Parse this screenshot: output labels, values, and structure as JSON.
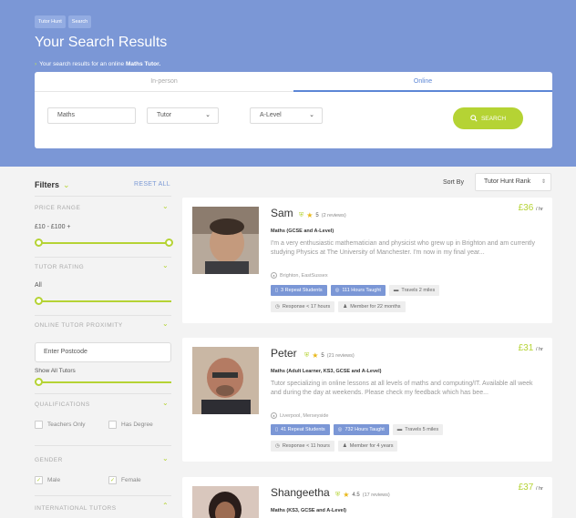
{
  "breadcrumbs": [
    "Tutor Hunt",
    "Search"
  ],
  "hero": {
    "title": "Your Search Results",
    "subtitle_pre": "Your search results for an online",
    "subtitle_subject": "Maths Tutor."
  },
  "search": {
    "tabs": [
      {
        "label": "In-person"
      },
      {
        "label": "Online"
      }
    ],
    "subject_value": "Maths",
    "type_value": "Tutor",
    "level_value": "A-Level",
    "button_label": "SEARCH"
  },
  "filters": {
    "title": "Filters",
    "reset_label": "RESET ALL",
    "price_range_label": "PRICE RANGE",
    "price_range_value": "£10 - £100 +",
    "price_range_fill": [
      0,
      1
    ],
    "tutor_rating_label": "TUTOR RATING",
    "tutor_rating_value": "All",
    "proximity_label": "ONLINE TUTOR PROXIMITY",
    "postcode_placeholder": "Enter Postcode",
    "show_all_label": "Show All Tutors",
    "qualifications_label": "QUALIFICATIONS",
    "teachers_only_label": "Teachers Only",
    "has_degree_label": "Has Degree",
    "gender_label": "GENDER",
    "male_label": "Male",
    "female_label": "Female",
    "international_label": "INTERNATIONAL TUTORS"
  },
  "sort": {
    "label": "Sort By",
    "value": "Tutor Hunt Rank"
  },
  "tutors": [
    {
      "name": "Sam",
      "rating": "5",
      "reviews": "(2 reviews)",
      "price": "£36",
      "per": "/ hr",
      "subjects_pre": "Maths",
      "subjects_detail": "(GCSE and A-Level)",
      "bio": "I'm a very enthusiastic mathematician and physicist who grew up in Brighton and am currently studying Physics at The University of Manchester. I'm now in my final year...",
      "location": "Brighton, EastSussex",
      "repeat": "3 Repeat Students",
      "hours": "111 Hours Taught",
      "travels": "Travels 2 miles",
      "response": "Response < 17 hours",
      "member": "Member for 22 months"
    },
    {
      "name": "Peter",
      "rating": "5",
      "reviews": "(21 reviews)",
      "price": "£31",
      "per": "/ hr",
      "subjects_pre": "Maths",
      "subjects_detail": "(Adult Learner, KS3, GCSE and A-Level)",
      "bio": "Tutor specializing in online lessons at all levels of maths and computing/IT. Available all week and during the day at weekends. Please check my feedback which has bee...",
      "location": "Liverpool, Merseyside",
      "repeat": "41 Repeat Students",
      "hours": "732 Hours Taught",
      "travels": "Travels 5 miles",
      "response": "Response < 11 hours",
      "member": "Member for 4 years"
    },
    {
      "name": "Shangeetha",
      "rating": "4.5",
      "reviews": "(17 reviews)",
      "price": "£37",
      "per": "/ hr",
      "subjects_pre": "Maths",
      "subjects_detail": "(KS3, GCSE and A-Level)"
    }
  ],
  "colors": {
    "hero_blue": "#7b97d6",
    "accent_green": "#b5d334",
    "tab_active": "#5c86d6",
    "star": "#e9b81b"
  }
}
